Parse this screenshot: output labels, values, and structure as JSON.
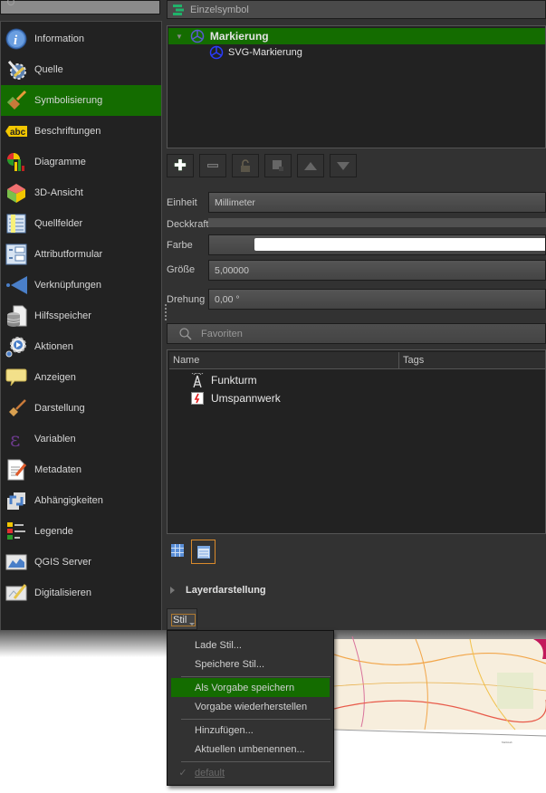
{
  "sidebar": {
    "search_placeholder": "",
    "active_index": 2,
    "items": [
      {
        "label": "Information",
        "icon": "information-icon"
      },
      {
        "label": "Quelle",
        "icon": "source-wrench-icon"
      },
      {
        "label": "Symbolisierung",
        "icon": "paintbrush-symbology-icon"
      },
      {
        "label": "Beschriftungen",
        "icon": "abc-label-icon"
      },
      {
        "label": "Diagramme",
        "icon": "diagram-icon"
      },
      {
        "label": "3D-Ansicht",
        "icon": "3d-cube-icon"
      },
      {
        "label": "Quellfelder",
        "icon": "source-fields-icon"
      },
      {
        "label": "Attributformular",
        "icon": "attribute-form-icon"
      },
      {
        "label": "Verknüpfungen",
        "icon": "joins-icon"
      },
      {
        "label": "Hilfsspeicher",
        "icon": "auxiliary-storage-icon"
      },
      {
        "label": "Aktionen",
        "icon": "actions-gear-icon"
      },
      {
        "label": "Anzeigen",
        "icon": "display-speech-bubble-icon"
      },
      {
        "label": "Darstellung",
        "icon": "rendering-brush-icon"
      },
      {
        "label": "Variablen",
        "icon": "variables-epsilon-icon"
      },
      {
        "label": "Metadaten",
        "icon": "metadata-icon"
      },
      {
        "label": "Abhängigkeiten",
        "icon": "dependencies-icon"
      },
      {
        "label": "Legende",
        "icon": "legend-icon"
      },
      {
        "label": "QGIS Server",
        "icon": "qgis-server-icon"
      },
      {
        "label": "Digitalisieren",
        "icon": "digitizing-icon"
      }
    ]
  },
  "renderer": {
    "label": "Einzelsymbol"
  },
  "symbol_tree": [
    {
      "label": "Markierung",
      "selected": true
    },
    {
      "label": "SVG-Markierung",
      "selected": false
    }
  ],
  "properties": {
    "unit_label": "Einheit",
    "unit_value": "Millimeter",
    "opacity_label": "Deckkraft",
    "color_label": "Farbe",
    "color_value": "#ffffff",
    "size_label": "Größe",
    "size_value": "5,00000",
    "rotation_label": "Drehung",
    "rotation_value": "0,00 °"
  },
  "favorites": {
    "placeholder": "Favoriten",
    "columns": [
      "Name",
      "Tags"
    ],
    "rows": [
      {
        "name": "Funkturm",
        "icon": "radio-tower-icon"
      },
      {
        "name": "Umspannwerk",
        "icon": "substation-lightning-icon"
      }
    ]
  },
  "layer_rendering": {
    "label": "Layerdarstellung"
  },
  "style_button": {
    "label": "Stil"
  },
  "style_menu": {
    "items": [
      {
        "label": "Lade Stil..."
      },
      {
        "label": "Speichere Stil..."
      },
      {
        "label": "Als Vorgabe speichern",
        "highlighted": true
      },
      {
        "label": "Vorgabe wiederherstellen"
      },
      {
        "label": "Hinzufügen..."
      },
      {
        "label": "Aktuellen umbenennen..."
      }
    ],
    "current_style": "default"
  },
  "colors": {
    "accent": "#146c00",
    "focus": "#d98a2b"
  }
}
